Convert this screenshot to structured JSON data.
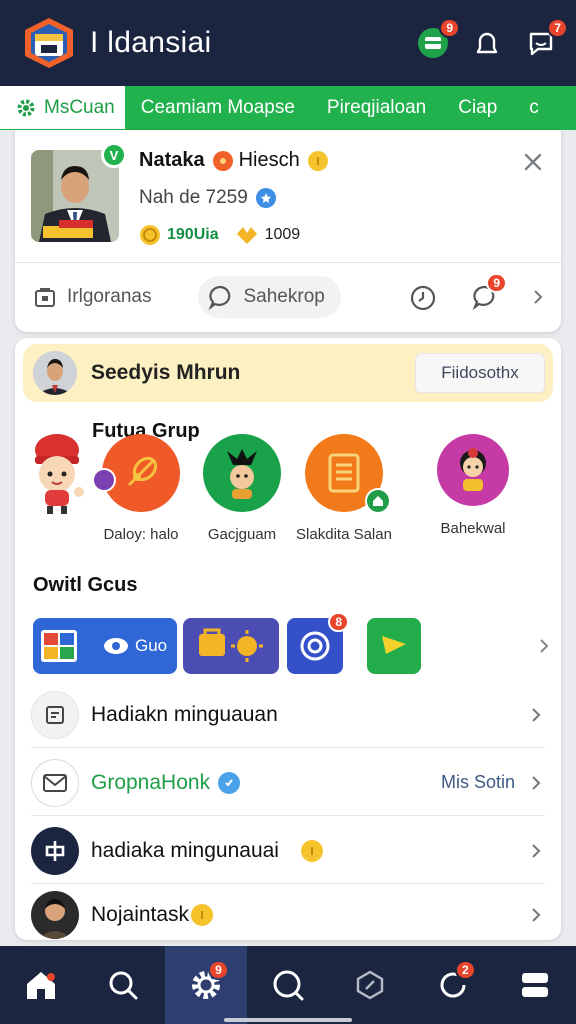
{
  "header": {
    "title": "I ldansiai",
    "icons": [
      {
        "name": "wallet-icon",
        "badge": "9"
      },
      {
        "name": "bell-icon",
        "badge": ""
      },
      {
        "name": "chat-icon",
        "badge": "7"
      }
    ]
  },
  "tabs": [
    {
      "label": "MsCuan",
      "active": true
    },
    {
      "label": "Ceamiam Moapse",
      "active": false
    },
    {
      "label": "Pireqjialoan",
      "active": false
    },
    {
      "label": "Ciap",
      "active": false
    },
    {
      "label": "c",
      "active": false
    }
  ],
  "profile": {
    "verify": "V",
    "name": "Nataka",
    "suffix": "Hiesch",
    "sub": "Nah de 7259",
    "coin_value": "190Uia",
    "gem_value": "1009",
    "actions": {
      "left": "Irlgoranas",
      "middle": "Sahekrop",
      "notif_badge": "9"
    }
  },
  "banner": {
    "title": "Seedyis Mhrun",
    "button": "Fiidosothx"
  },
  "groups": {
    "title": "Futua Grup",
    "items": [
      {
        "label": "Daloy: halo",
        "color": "#f05a28"
      },
      {
        "label": "Gacjguam",
        "color": "#19a24a"
      },
      {
        "label": "Slakdita Salan",
        "color": "#f27a1a"
      },
      {
        "label": "Bahekwal",
        "color": "#c63aa5"
      }
    ]
  },
  "apps": {
    "title": "Owitl Gcus",
    "tile_text": "Guo",
    "badge": "8"
  },
  "list": [
    {
      "label": "Hadiakn minguauan",
      "icon": "calendar-icon",
      "right": "",
      "green": false
    },
    {
      "label": "GropnaHonk",
      "icon": "mail-icon",
      "right": "Mis Sotin",
      "green": true
    },
    {
      "label": "hadiaka mingunauai",
      "icon": "app-icon",
      "right": "",
      "green": false
    },
    {
      "label": "Nojaintask",
      "icon": "user-icon",
      "right": "",
      "green": false
    }
  ],
  "bottom_nav": [
    {
      "name": "home",
      "badge": ""
    },
    {
      "name": "search",
      "badge": ""
    },
    {
      "name": "settings",
      "badge": "9"
    },
    {
      "name": "search-alt",
      "badge": ""
    },
    {
      "name": "compass",
      "badge": ""
    },
    {
      "name": "refresh",
      "badge": "2"
    },
    {
      "name": "menu",
      "badge": ""
    }
  ],
  "colors": {
    "brand_green": "#21b24d",
    "navy": "#1c2540",
    "badge_red": "#e8452c"
  }
}
